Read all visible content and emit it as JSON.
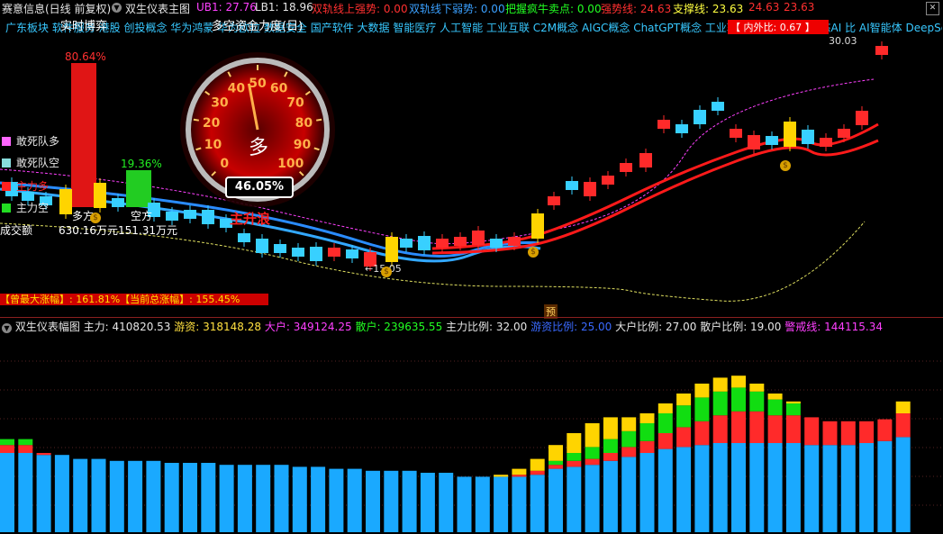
{
  "topbar": {
    "title": "赛意信息(日线 前复权)",
    "indicator": "双生仪表主图",
    "ub1_label": "UB1: 27.76",
    "lb1_label": "LB1: 18.96",
    "up_strong": "双轨线上强势: 0.00",
    "down_weak": "双轨线下弱势: 0.00",
    "bull_point": "把握疯牛卖点: 0.00",
    "strong_line": "强势线: 24.63",
    "support_line": "支撑线: 23.63",
    "extra1": "24.63",
    "extra2": "23.63"
  },
  "sectors": "广东板块 软件服务 港股 创投概念 华为鸿蒙 华为欧拉 数据安全 国产软件 大数据 智能医疗 人工智能 工业互联 C2M概念 AIGC概念 ChatGPT概念 工业软件 百度概念 多模态AI 比 AI智能体 DeepSeek",
  "ratio_box": "【 内外比: 0.67 】",
  "gauge": {
    "title_left": "实时博弈",
    "title_right": "多空资金力度(日)",
    "ticks": [
      "0",
      "10",
      "20",
      "30",
      "40",
      "50",
      "60",
      "70",
      "80",
      "90",
      "100"
    ],
    "center_label": "多",
    "readout": "46.05%",
    "value": 46.05
  },
  "legend": [
    {
      "label": "敢死队多",
      "color": "#ff66ff"
    },
    {
      "label": "敢死队空",
      "color": "#88dddd"
    },
    {
      "label": "主力多",
      "color": "#ff2020"
    },
    {
      "label": "主力空",
      "color": "#22dd22"
    }
  ],
  "annotations": {
    "pct_max": "80.64%",
    "pct_second": "19.36%",
    "volume_label": "成交额",
    "vol_left": "630.16万元",
    "vol_right": "151.31万元",
    "many": "多方",
    "empty": "空方",
    "main_rise": "主升浪",
    "low_price": "←15.05",
    "high_price": "30.03",
    "max_rise": "【曾最大涨幅】: 161.81%【当前总涨幅】: 155.45%",
    "forecast": "预"
  },
  "sub": {
    "title": "双生仪表幅图",
    "main": "主力: 410820.53",
    "hot": "游资: 318148.28",
    "big": "大户: 349124.25",
    "retail": "散户: 239635.55",
    "main_ratio": "主力比例: 32.00",
    "hot_ratio": "游资比例: 25.00",
    "big_ratio": "大户比例: 27.00",
    "retail_ratio": "散户比例: 19.00",
    "warn": "警戒线: 144115.34"
  },
  "chart_data": {
    "type": "bar",
    "series": [
      {
        "values": [
          0.4,
          0.4,
          0.39,
          0.39,
          0.37,
          0.37,
          0.36,
          0.36,
          0.36,
          0.35,
          0.35,
          0.35,
          0.34,
          0.34,
          0.34,
          0.34,
          0.33,
          0.33,
          0.32,
          0.32,
          0.31,
          0.31,
          0.31,
          0.3,
          0.3,
          0.28,
          0.28,
          0.28,
          0.28,
          0.29,
          0.32,
          0.33,
          0.34,
          0.36,
          0.38,
          0.4,
          0.42,
          0.43,
          0.44,
          0.45,
          0.45,
          0.45,
          0.45,
          0.45,
          0.44,
          0.44,
          0.44,
          0.45,
          0.46,
          0.48
        ]
      },
      {
        "values": [
          0.04,
          0.04,
          0.01,
          0.0,
          0.0,
          0.0,
          0.0,
          0.0,
          0.0,
          0.0,
          0.0,
          0.0,
          0.0,
          0.0,
          0.0,
          0.0,
          0.0,
          0.0,
          0.0,
          0.0,
          0.0,
          0.0,
          0.0,
          0.0,
          0.0,
          0.0,
          0.0,
          0.0,
          0.01,
          0.02,
          0.02,
          0.03,
          0.03,
          0.04,
          0.05,
          0.06,
          0.08,
          0.1,
          0.12,
          0.14,
          0.16,
          0.16,
          0.14,
          0.14,
          0.14,
          0.12,
          0.12,
          0.11,
          0.11,
          0.12
        ]
      },
      {
        "values": [
          0.03,
          0.03,
          0.0,
          0.0,
          0.0,
          0.0,
          0.0,
          0.0,
          0.0,
          0.0,
          0.0,
          0.0,
          0.0,
          0.0,
          0.0,
          0.0,
          0.0,
          0.0,
          0.0,
          0.0,
          0.0,
          0.0,
          0.0,
          0.0,
          0.0,
          0.0,
          0.0,
          0.0,
          0.0,
          0.0,
          0.02,
          0.04,
          0.06,
          0.07,
          0.08,
          0.09,
          0.1,
          0.11,
          0.12,
          0.12,
          0.12,
          0.1,
          0.08,
          0.06,
          0.0,
          0.0,
          0.0,
          0.0,
          0.0,
          0.0
        ]
      },
      {
        "values": [
          0.0,
          0.0,
          0.0,
          0.0,
          0.0,
          0.0,
          0.0,
          0.0,
          0.0,
          0.0,
          0.0,
          0.0,
          0.0,
          0.0,
          0.0,
          0.0,
          0.0,
          0.0,
          0.0,
          0.0,
          0.0,
          0.0,
          0.0,
          0.0,
          0.0,
          0.0,
          0.0,
          0.01,
          0.03,
          0.06,
          0.08,
          0.1,
          0.12,
          0.11,
          0.07,
          0.05,
          0.05,
          0.06,
          0.07,
          0.07,
          0.06,
          0.04,
          0.03,
          0.01,
          0.0,
          0.0,
          0.0,
          0.0,
          0.0,
          0.06
        ]
      }
    ],
    "colors": [
      "#1aa9ff",
      "#ff2a2a",
      "#11dd11",
      "#ffd400"
    ]
  }
}
